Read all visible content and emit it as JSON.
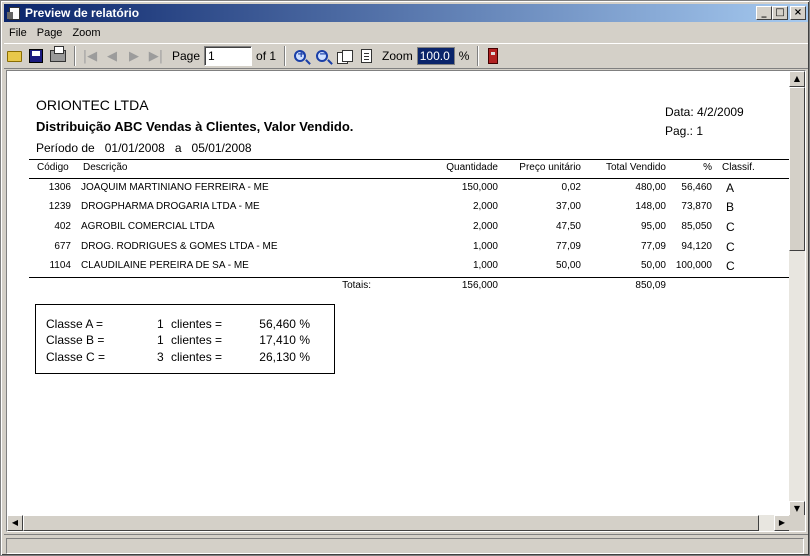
{
  "window": {
    "title": "Preview de relatório",
    "buttons": {
      "minimize": "_",
      "maximize": "□",
      "close": "×"
    }
  },
  "menu": {
    "file": "File",
    "page": "Page",
    "zoom": "Zoom"
  },
  "toolbar": {
    "page_label": "Page",
    "page_value": "1",
    "of_label": "of 1",
    "zoom_label": "Zoom",
    "zoom_value": "100.0",
    "percent": "%"
  },
  "report": {
    "company": "ORIONTEC  LTDA",
    "subtitle": "Distribuição ABC Vendas à  Clientes, Valor Vendido.",
    "period_label": "Período de",
    "period_from": "01/01/2008",
    "period_a": "a",
    "period_to": "05/01/2008",
    "date": "Data: 4/2/2009",
    "page": "Pag.: 1",
    "columns": {
      "codigo": "Código",
      "descricao": "Descrição",
      "quantidade": "Quantidade",
      "preco": "Preço unitário",
      "total": "Total Vendido",
      "pct": "%",
      "classif": "Classif."
    },
    "rows": [
      {
        "codigo": "1306",
        "descricao": "JOAQUIM  MARTINIANO  FERREIRA  -  ME",
        "quantidade": "150,000",
        "preco": "0,02",
        "total": "480,00",
        "pct": "56,460",
        "classif": "A"
      },
      {
        "codigo": "1239",
        "descricao": "DROGPHARMA  DROGARIA  LTDA  -  ME",
        "quantidade": "2,000",
        "preco": "37,00",
        "total": "148,00",
        "pct": "73,870",
        "classif": "B"
      },
      {
        "codigo": "402",
        "descricao": "AGROBIL  COMERCIAL  LTDA",
        "quantidade": "2,000",
        "preco": "47,50",
        "total": "95,00",
        "pct": "85,050",
        "classif": "C"
      },
      {
        "codigo": "677",
        "descricao": "DROG.  RODRIGUES  &  GOMES  LTDA  -  ME",
        "quantidade": "1,000",
        "preco": "77,09",
        "total": "77,09",
        "pct": "94,120",
        "classif": "C"
      },
      {
        "codigo": "1104",
        "descricao": "CLAUDILAINE  PEREIRA  DE  SA  -  ME",
        "quantidade": "1,000",
        "preco": "50,00",
        "total": "50,00",
        "pct": "100,000",
        "classif": "C"
      }
    ],
    "totals": {
      "label": "Totais:",
      "quantidade": "156,000",
      "total": "850,09"
    },
    "classes": [
      {
        "label": "Classe A =",
        "count": "1",
        "clientes": "clientes =",
        "pct": "56,460 %"
      },
      {
        "label": "Classe B =",
        "count": "1",
        "clientes": "clientes =",
        "pct": "17,410 %"
      },
      {
        "label": "Classe C =",
        "count": "3",
        "clientes": "clientes =",
        "pct": "26,130 %"
      }
    ]
  },
  "icons": {
    "open": "folder-icon",
    "save": "save-icon",
    "print": "printer-icon",
    "first": "first-page-icon",
    "prev": "prev-page-icon",
    "next": "next-page-icon",
    "last": "last-page-icon",
    "zoom_in": "zoom-in-icon",
    "zoom_out": "zoom-out-icon",
    "page_width": "page-width-icon",
    "full_page": "full-page-icon",
    "exit": "exit-icon"
  },
  "colors": {
    "title_bar_start": "#0a246a",
    "title_bar_end": "#a6caf0",
    "window_bg": "#d4d0c8"
  }
}
